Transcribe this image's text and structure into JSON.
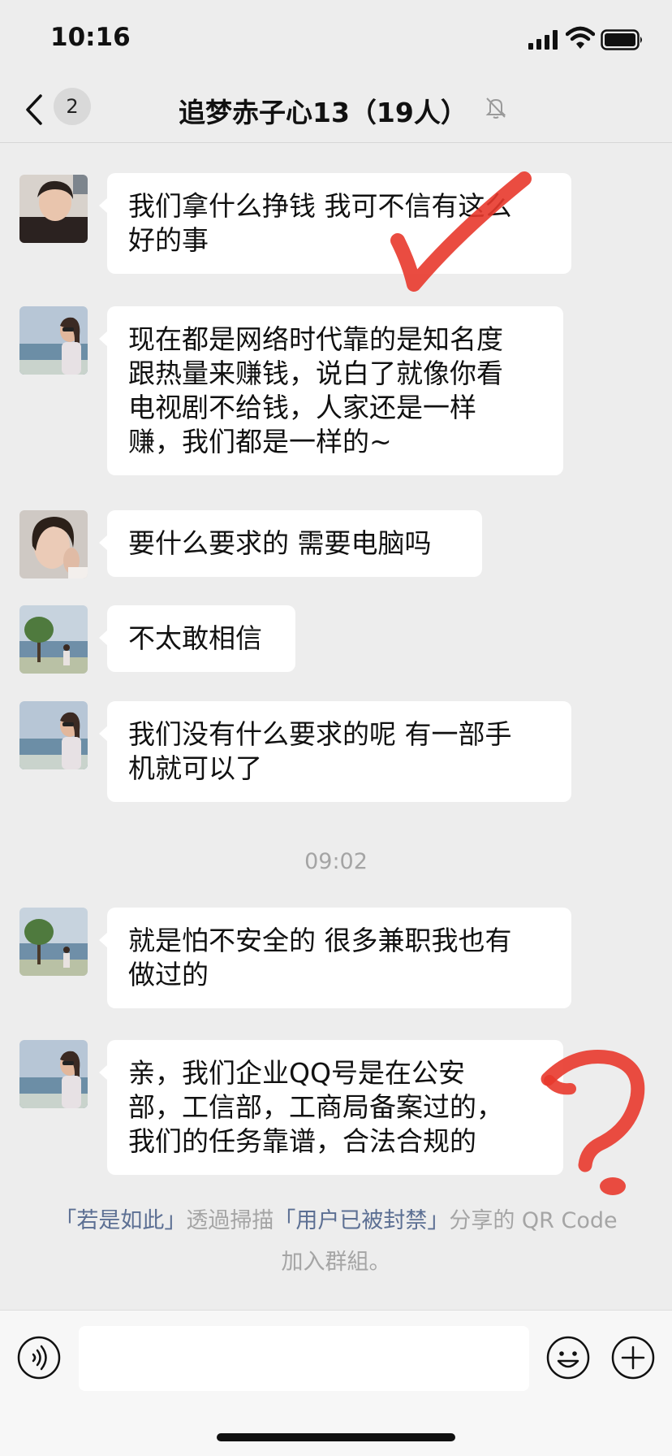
{
  "status_bar": {
    "time": "10:16"
  },
  "header": {
    "unread_count": "2",
    "title": "追梦赤子心13（19人）"
  },
  "messages": [
    {
      "lines": [
        "我们拿什么挣钱 我可不信有这么",
        "好的事"
      ]
    },
    {
      "lines": [
        "现在都是网络时代靠的是知名度",
        "跟热量来赚钱，说白了就像你看",
        "电视剧不给钱，人家还是一样",
        "赚，我们都是一样的~"
      ]
    },
    {
      "lines": [
        "要什么要求的 需要电脑吗"
      ]
    },
    {
      "lines": [
        "不太敢相信"
      ]
    },
    {
      "lines": [
        "我们没有什么要求的呢 有一部手",
        "机就可以了"
      ]
    },
    {
      "lines": [
        "就是怕不安全的 很多兼职我也有",
        "做过的"
      ]
    },
    {
      "lines": [
        "亲，我们企业QQ号是在公安",
        "部，工信部，工商局备案过的，",
        "我们的任务靠谱，合法合规的"
      ]
    }
  ],
  "time_separator": "09:02",
  "system_notice": {
    "name1": "「若是如此」",
    "text1": "透過掃描",
    "name2": "「用户已被封禁」",
    "text2": "分享的 QR Code 加入群組。"
  },
  "input_bar": {
    "placeholder": ""
  },
  "colors": {
    "background": "#ededed",
    "bubble": "#ffffff",
    "link": "#5c6f93",
    "annotation_red": "#e8382c"
  }
}
